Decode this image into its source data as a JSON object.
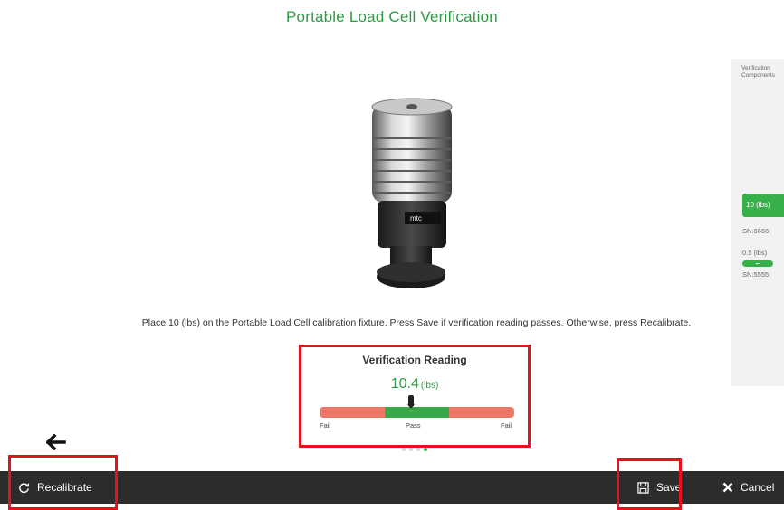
{
  "page": {
    "title": "Portable Load Cell Verification",
    "instruction": "Place 10 (lbs) on the Portable Load Cell calibration fixture. Press Save if verification reading passes. Otherwise, press Recalibrate."
  },
  "device_image": {
    "logo_text": "mtc"
  },
  "side_panel": {
    "header": "Verification Components",
    "components": [
      {
        "weight": "10 (lbs)",
        "serial": "SN:6666",
        "active": true
      },
      {
        "weight": "0.5 (lbs)",
        "serial": "SN:5555",
        "active": false
      }
    ]
  },
  "reading": {
    "heading": "Verification Reading",
    "value": "10.4",
    "unit": "(lbs)",
    "gauge_labels": {
      "fail_left": "Fail",
      "pass": "Pass",
      "fail_right": "Fail"
    },
    "needle_fraction": 0.47,
    "pager": {
      "count": 4,
      "active_index": 3
    }
  },
  "bottom_bar": {
    "recalibrate_label": "Recalibrate",
    "save_label": "Save",
    "cancel_label": "Cancel"
  },
  "colors": {
    "accent_green": "#2e9a45",
    "pass_green": "#38a84a",
    "fail_red": "#ee7868",
    "highlight_red": "#e8111b",
    "bottom_bar": "#2c2c2c"
  }
}
